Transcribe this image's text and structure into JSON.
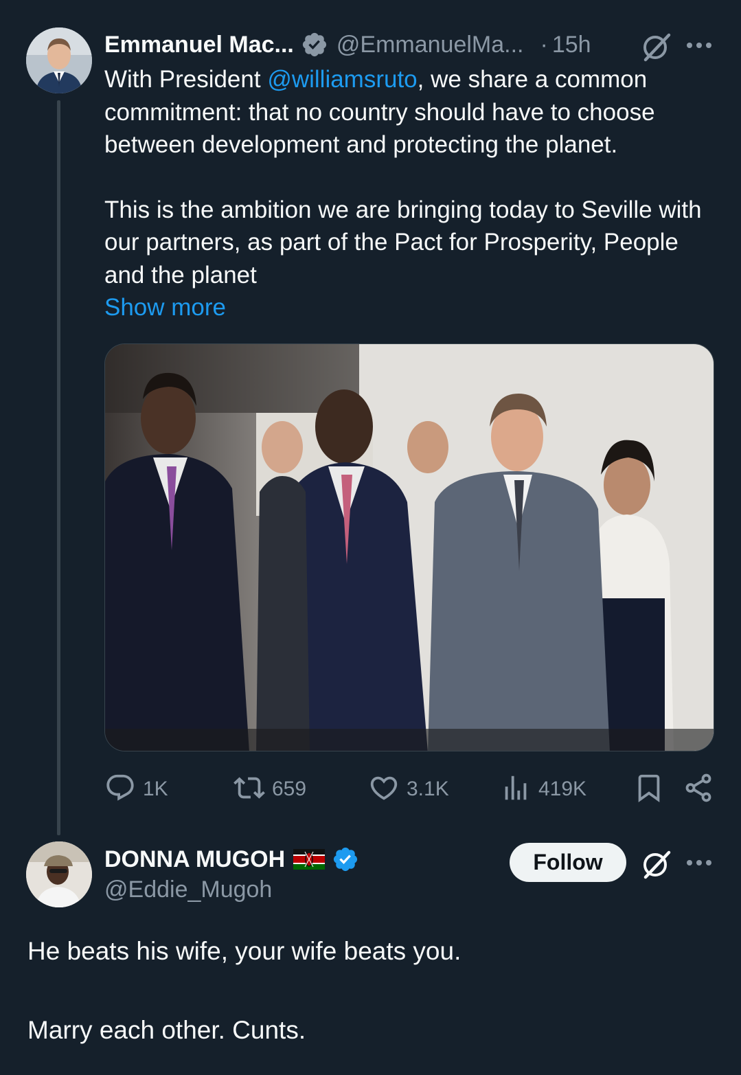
{
  "tweet": {
    "author": {
      "name": "Emmanuel Mac...",
      "handle": "@EmmanuelMa...",
      "verified": true
    },
    "separator": "·",
    "time": "15h",
    "text": {
      "line_prefix": "With President ",
      "mention": "@williamsruto",
      "line_rest": ", we share a common commitment: that no country should have to choose between development and protecting the planet.",
      "paragraph2": "This is the ambition we are bringing today to Seville with our partners, as part of the Pact for Prosperity, People and the planet"
    },
    "show_more": "Show more",
    "media_icon": "photo",
    "stats": {
      "replies": "1K",
      "reposts": "659",
      "likes": "3.1K",
      "views": "419K"
    },
    "icons": {
      "verified": "verified-badge-icon",
      "grok": "grok-icon",
      "more": "more-icon",
      "reply": "reply-icon",
      "repost": "repost-icon",
      "like": "heart-icon",
      "views": "views-chart-icon",
      "bookmark": "bookmark-icon",
      "share": "share-icon"
    }
  },
  "reply": {
    "author": {
      "name": "DONNA MUGOH",
      "handle": "@Eddie_Mugoh",
      "verified": true,
      "flag": "kenya-flag"
    },
    "follow_label": "Follow",
    "text": {
      "line1": "He beats his wife, your wife beats you.",
      "line2": "Marry each other. Cunts."
    }
  },
  "colors": {
    "background": "#15202b",
    "text": "#f7f9f9",
    "secondary": "#8b98a5",
    "accent": "#1d9bf0",
    "divider": "#38444d"
  }
}
